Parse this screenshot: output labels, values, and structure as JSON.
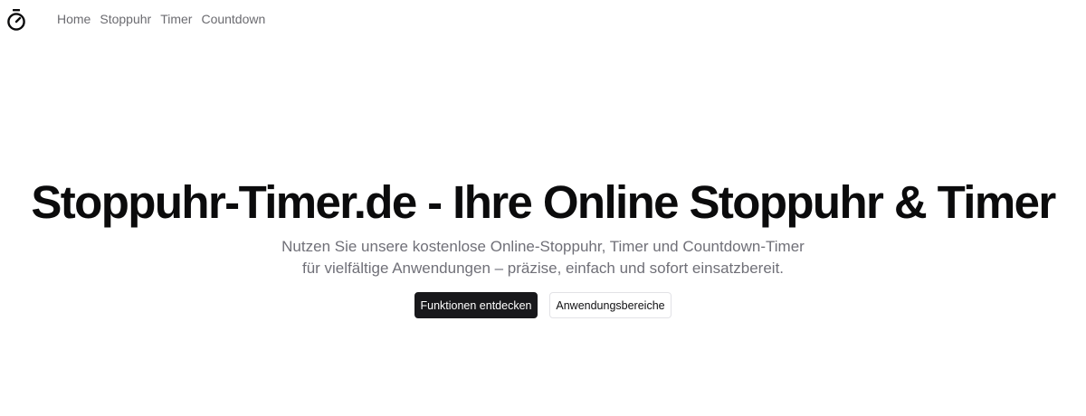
{
  "header": {
    "logo_icon": "stopwatch-icon",
    "nav": [
      {
        "label": "Home"
      },
      {
        "label": "Stoppuhr"
      },
      {
        "label": "Timer"
      },
      {
        "label": "Countdown"
      }
    ]
  },
  "hero": {
    "title": "Stoppuhr-Timer.de - Ihre Online Stoppuhr & Timer",
    "subtitle_line1": "Nutzen Sie unsere kostenlose Online-Stoppuhr, Timer und Countdown-Timer",
    "subtitle_line2": "für vielfältige Anwendungen – präzise, einfach und sofort einsatzbereit.",
    "primary_button": "Funktionen entdecken",
    "secondary_button": "Anwendungsbereiche"
  },
  "colors": {
    "primary_button_bg": "#18181b",
    "text_muted": "#707078",
    "title": "#0b0b0c"
  }
}
